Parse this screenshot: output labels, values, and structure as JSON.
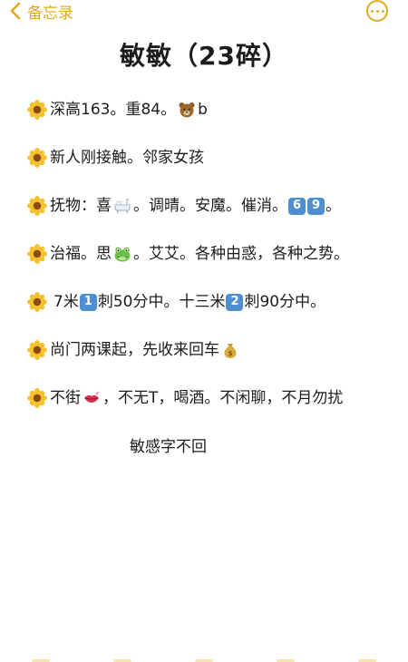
{
  "nav": {
    "back_label": "备忘录",
    "accent_color": "#e2aa1e"
  },
  "note": {
    "title": "敏敏（23碎）",
    "lines": [
      {
        "a": "深高163。重84。",
        "b": "b"
      },
      {
        "a": "新人刚接触。邻家女孩"
      },
      {
        "a": "抚物：喜",
        "b": "。调晴。安魔。催消。",
        "k1": "6",
        "k2": "9",
        "c": "。"
      },
      {
        "a": "治福。思",
        "b": "。艾艾。各种由惑，各种之势。"
      },
      {
        "a": "7米",
        "k1": "1",
        "b": "刺50分中。十三米",
        "k2": "2",
        "c": "刺90分中。"
      },
      {
        "a": "尚门两课起，先收来回车"
      },
      {
        "a": "不街",
        "b": "，不无T，喝酒。不闲聊，不月勿扰"
      }
    ],
    "footer_line": "敏感字不回"
  },
  "icons": {
    "bullet": "sunflower-icon",
    "bear": "bear-icon",
    "bathtub": "bathtub-icon",
    "frog": "frog-icon",
    "money_bag": "money-bag-icon",
    "lips": "lips-icon"
  }
}
